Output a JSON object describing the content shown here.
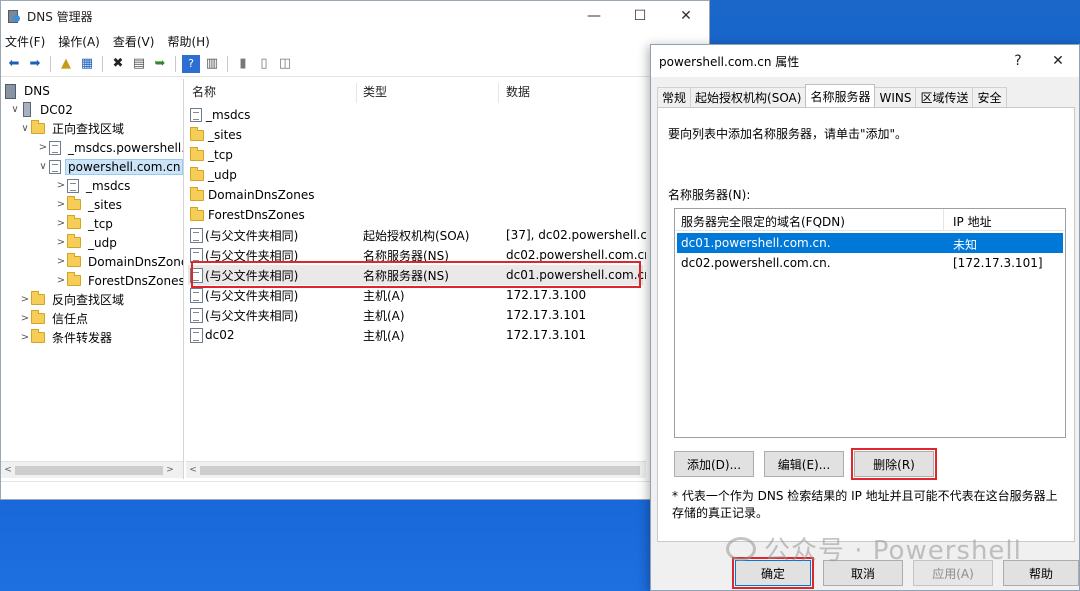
{
  "main_window": {
    "title": "DNS 管理器",
    "controls": {
      "minimize": "—",
      "maximize": "☐",
      "close": "✕"
    },
    "menu": [
      "文件(F)",
      "操作(A)",
      "查看(V)",
      "帮助(H)"
    ],
    "tree": [
      {
        "label": "DNS",
        "icon": "dns-icon",
        "depth": 0,
        "twisty": ""
      },
      {
        "label": "DC02",
        "icon": "server-icon",
        "depth": 1,
        "twisty": "∨"
      },
      {
        "label": "正向查找区域",
        "icon": "folder-icon",
        "depth": 2,
        "twisty": "∨"
      },
      {
        "label": "_msdcs.powershell.",
        "icon": "zone-icon",
        "depth": 3,
        "twisty": ">"
      },
      {
        "label": "powershell.com.cn",
        "icon": "zone-icon",
        "depth": 3,
        "twisty": "∨",
        "selected": true
      },
      {
        "label": "_msdcs",
        "icon": "zone-icon",
        "depth": 4,
        "twisty": ">"
      },
      {
        "label": "_sites",
        "icon": "folder-icon",
        "depth": 4,
        "twisty": ">"
      },
      {
        "label": "_tcp",
        "icon": "folder-icon",
        "depth": 4,
        "twisty": ">"
      },
      {
        "label": "_udp",
        "icon": "folder-icon",
        "depth": 4,
        "twisty": ">"
      },
      {
        "label": "DomainDnsZone",
        "icon": "folder-icon",
        "depth": 4,
        "twisty": ">"
      },
      {
        "label": "ForestDnsZones",
        "icon": "folder-icon",
        "depth": 4,
        "twisty": ">"
      },
      {
        "label": "反向查找区域",
        "icon": "folder-icon",
        "depth": 2,
        "twisty": ">"
      },
      {
        "label": "信任点",
        "icon": "folder-icon",
        "depth": 2,
        "twisty": ">"
      },
      {
        "label": "条件转发器",
        "icon": "folder-icon",
        "depth": 2,
        "twisty": ">"
      }
    ],
    "list": {
      "columns": [
        "名称",
        "类型",
        "数据"
      ],
      "rows": [
        {
          "name": "_msdcs",
          "type": "",
          "data": "",
          "icon": "zone-icon"
        },
        {
          "name": "_sites",
          "type": "",
          "data": "",
          "icon": "folder-icon"
        },
        {
          "name": "_tcp",
          "type": "",
          "data": "",
          "icon": "folder-icon"
        },
        {
          "name": "_udp",
          "type": "",
          "data": "",
          "icon": "folder-icon"
        },
        {
          "name": "DomainDnsZones",
          "type": "",
          "data": "",
          "icon": "folder-icon"
        },
        {
          "name": "ForestDnsZones",
          "type": "",
          "data": "",
          "icon": "folder-icon"
        },
        {
          "name": "(与父文件夹相同)",
          "type": "起始授权机构(SOA)",
          "data": "[37], dc02.powershell.c...",
          "icon": "record-icon"
        },
        {
          "name": "(与父文件夹相同)",
          "type": "名称服务器(NS)",
          "data": "dc02.powershell.com.cn.",
          "icon": "record-icon"
        },
        {
          "name": "(与父文件夹相同)",
          "type": "名称服务器(NS)",
          "data": "dc01.powershell.com.cn.",
          "icon": "record-icon",
          "highlight": true
        },
        {
          "name": "(与父文件夹相同)",
          "type": "主机(A)",
          "data": "172.17.3.100",
          "icon": "record-icon"
        },
        {
          "name": "(与父文件夹相同)",
          "type": "主机(A)",
          "data": "172.17.3.101",
          "icon": "record-icon"
        },
        {
          "name": "dc02",
          "type": "主机(A)",
          "data": "172.17.3.101",
          "icon": "record-icon"
        }
      ]
    }
  },
  "dialog": {
    "title": "powershell.com.cn 属性",
    "help": "?",
    "close": "✕",
    "tabs": [
      "常规",
      "起始授权机构(SOA)",
      "名称服务器",
      "WINS",
      "区域传送",
      "安全"
    ],
    "active_tab": "名称服务器",
    "hint": "要向列表中添加名称服务器，请单击\"添加\"。",
    "ns_label": "名称服务器(N):",
    "ns_columns": [
      "服务器完全限定的域名(FQDN)",
      "IP 地址"
    ],
    "ns_rows": [
      {
        "fqdn": "dc01.powershell.com.cn.",
        "ip": "未知",
        "selected": true
      },
      {
        "fqdn": "dc02.powershell.com.cn.",
        "ip": "[172.17.3.101]"
      }
    ],
    "buttons": {
      "add": "添加(D)...",
      "edit": "编辑(E)...",
      "remove": "删除(R)"
    },
    "footnote": "* 代表一个作为 DNS 检索结果的 IP 地址并且可能不代表在这台服务器上存储的真正记录。",
    "footer": {
      "ok": "确定",
      "cancel": "取消",
      "apply": "应用(A)",
      "help": "帮助"
    }
  },
  "watermark": "公众号 · Powershell"
}
